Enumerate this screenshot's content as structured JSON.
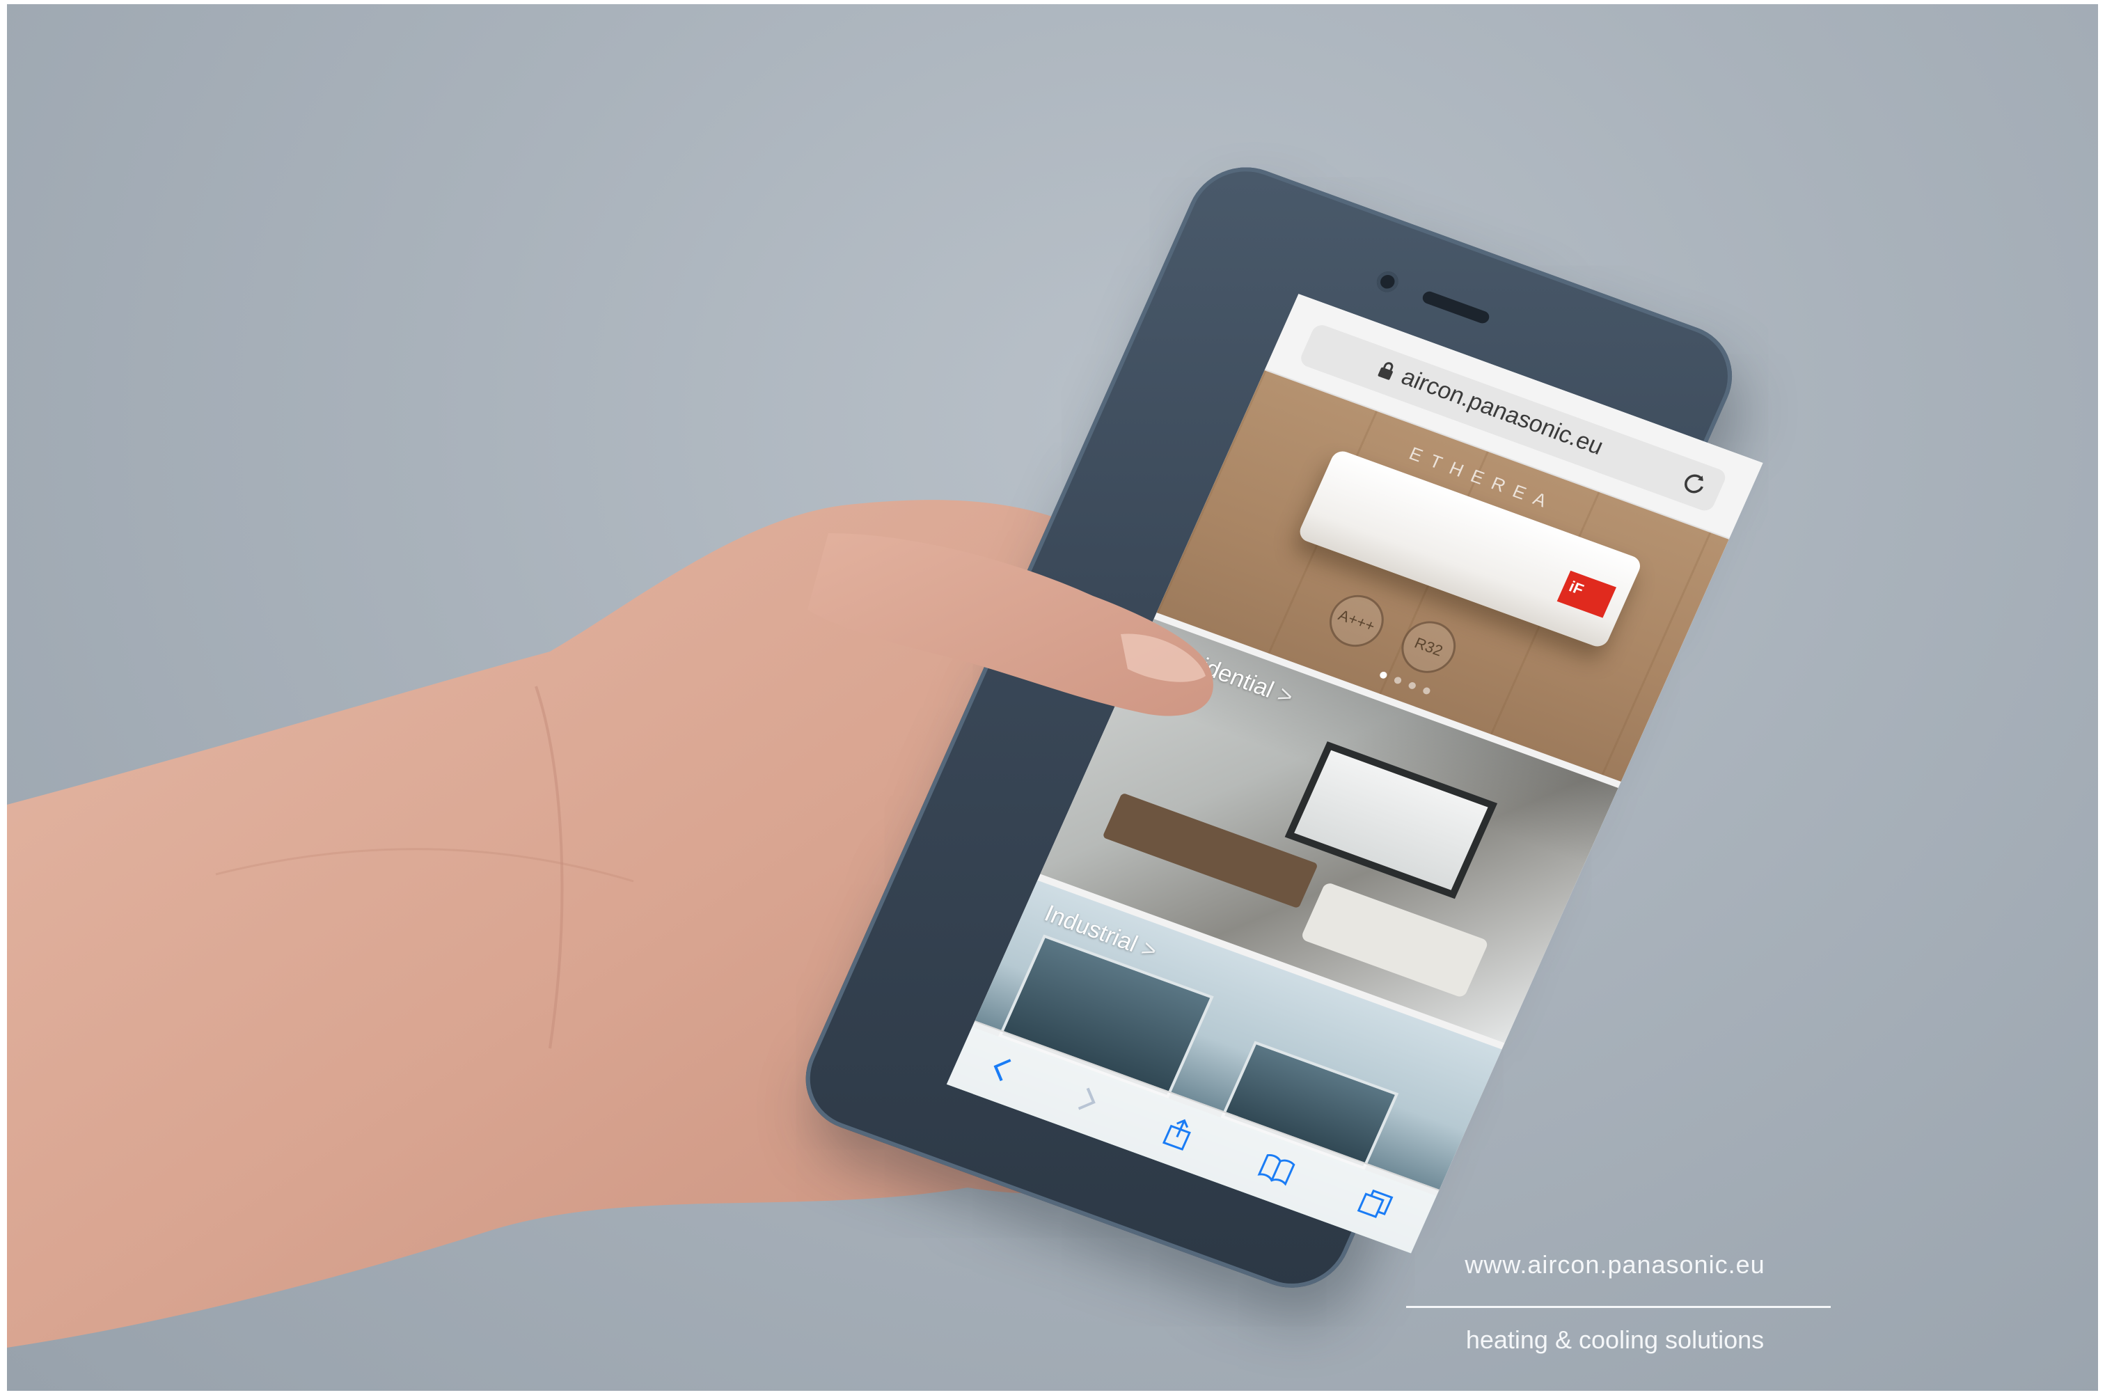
{
  "browser": {
    "url": "aircon.panasonic.eu",
    "icons": [
      "lock-icon",
      "reload-icon"
    ]
  },
  "hero": {
    "brand": "ETHEREA",
    "badge": "iF",
    "icon_labels": [
      "A+++",
      "R32"
    ],
    "slides": 4,
    "active_slide": 1
  },
  "categories": [
    {
      "label": "Residential",
      "chevron": ">"
    },
    {
      "label": "Industrial",
      "chevron": ">"
    }
  ],
  "toolbar": {
    "icons": [
      "back-icon",
      "forward-icon",
      "share-icon",
      "bookmarks-icon",
      "tabs-icon"
    ]
  },
  "caption": {
    "url": "www.aircon.panasonic.eu",
    "tagline": "heating & cooling solutions"
  },
  "colors": {
    "background": "#a9b2bb",
    "phone_body": "#3a4858",
    "ios_blue": "#1a7cf5",
    "award_red": "#e02a1e",
    "caption_text": "#f5f7f9"
  }
}
